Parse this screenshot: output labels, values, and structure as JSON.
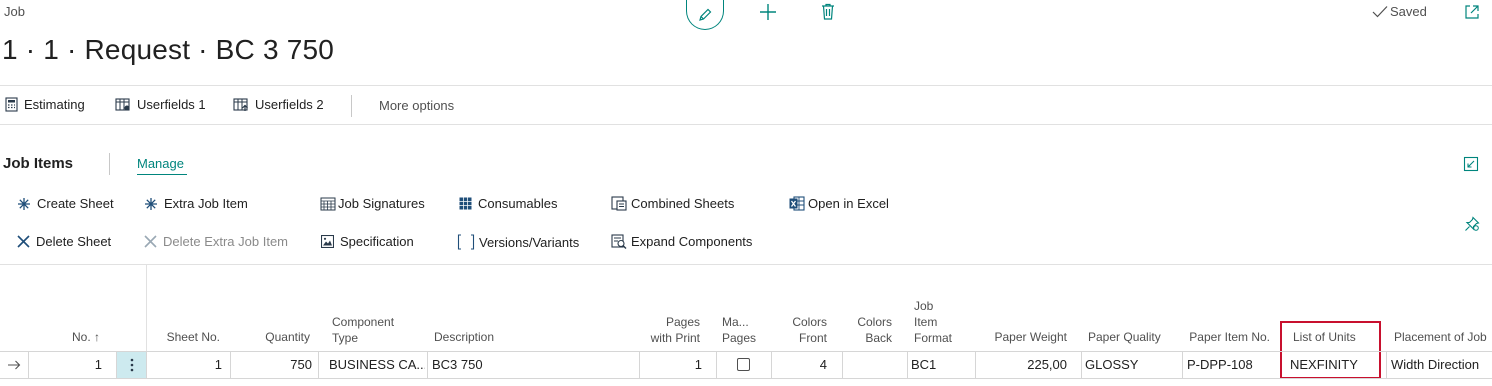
{
  "header": {
    "breadcrumb": "Job",
    "title": "1 · 1 · Request · BC 3 750",
    "saved_label": "Saved"
  },
  "actions": {
    "estimating": "Estimating",
    "userfields1": "Userfields 1",
    "userfields2": "Userfields 2",
    "more_options": "More options"
  },
  "part": {
    "title": "Job Items",
    "manage_tab": "Manage"
  },
  "part_actions": {
    "create_sheet": "Create Sheet",
    "extra_job_item": "Extra Job Item",
    "job_signatures": "Job Signatures",
    "consumables": "Consumables",
    "combined_sheets": "Combined Sheets",
    "open_in_excel": "Open in Excel",
    "delete_sheet": "Delete Sheet",
    "delete_extra_job_item": "Delete Extra Job Item",
    "specification": "Specification",
    "versions_variants": "Versions/Variants",
    "expand_components": "Expand Components"
  },
  "table": {
    "columns": {
      "no": "No. ↑",
      "sheet_no": "Sheet No.",
      "quantity": "Quantity",
      "component_type_1": "Component",
      "component_type_2": "Type",
      "description": "Description",
      "pages_with_print_1": "Pages",
      "pages_with_print_2": "with Print",
      "ma_pages_1": "Ma...",
      "ma_pages_2": "Pages",
      "colors_front_1": "Colors",
      "colors_front_2": "Front",
      "colors_back_1": "Colors",
      "colors_back_2": "Back",
      "job_item_format_1": "Job",
      "job_item_format_2": "Item",
      "job_item_format_3": "Format",
      "paper_weight": "Paper Weight",
      "paper_quality": "Paper Quality",
      "paper_item_no": "Paper Item No.",
      "list_of_units": "List of Units",
      "placement_of_job": "Placement of Job"
    },
    "row": {
      "no": "1",
      "sheet_no": "1",
      "quantity": "750",
      "component_type": "BUSINESS CA...",
      "description": "BC3 750",
      "pages_with_print": "1",
      "ma_pages_checked": false,
      "colors_front": "4",
      "colors_back": "",
      "job_item_format": "BC1",
      "paper_weight": "225,00",
      "paper_quality": "GLOSSY",
      "paper_item_no": "P-DPP-108",
      "list_of_units": "NEXFINITY",
      "placement_of_job": "Width Direction"
    }
  },
  "colors": {
    "accent": "#00857d",
    "highlight_border": "#c8102e",
    "selection_cell": "#cdeaef"
  },
  "icons": [
    "edit-icon",
    "plus-icon",
    "trash-icon",
    "check-icon",
    "popout-icon",
    "calculator-icon",
    "userfields-icon",
    "collapse-icon",
    "create-sheet-icon",
    "extra-job-item-icon",
    "signatures-icon",
    "consumables-icon",
    "combined-sheets-icon",
    "excel-icon",
    "close-x-icon",
    "specification-icon",
    "bracket-icon",
    "expand-components-icon",
    "pin-icon",
    "row-arrow-icon",
    "row-menu-icon"
  ]
}
